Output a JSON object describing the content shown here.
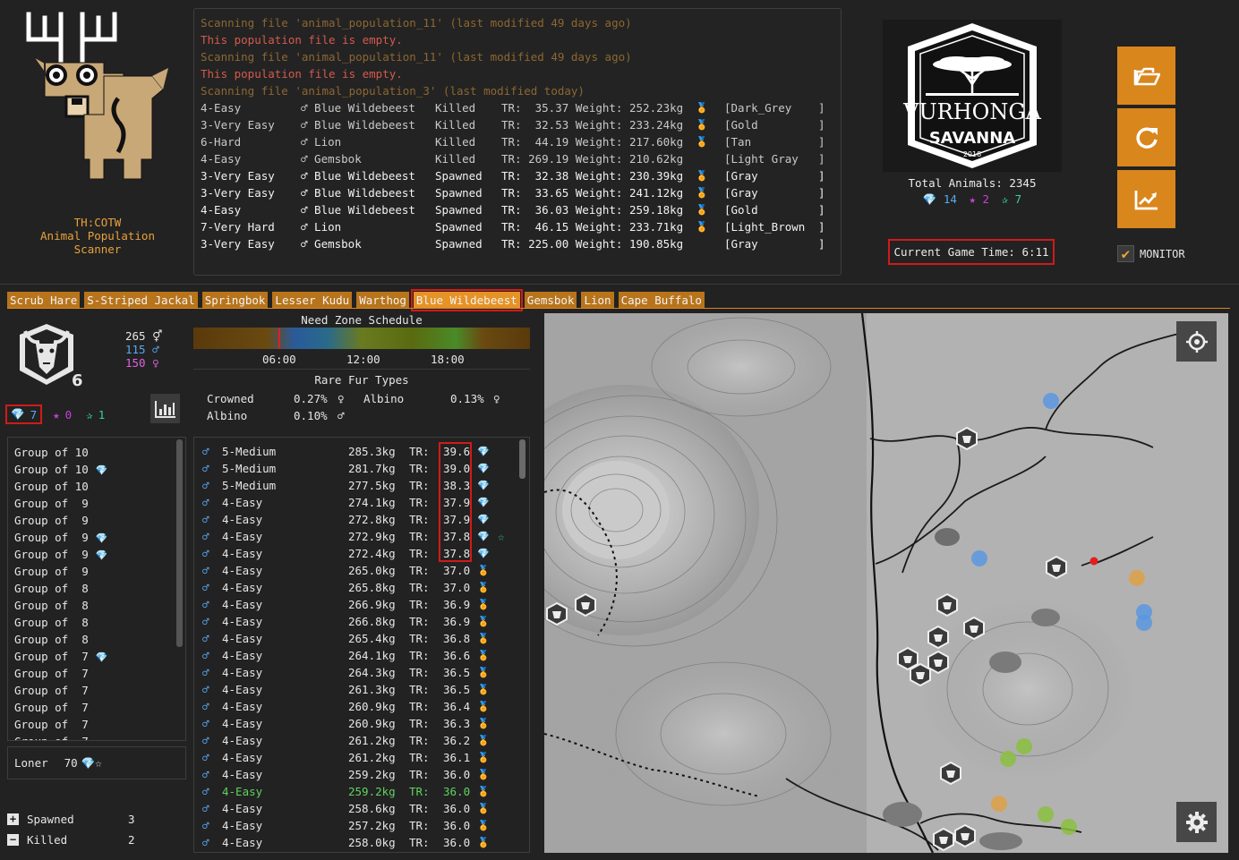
{
  "app": {
    "title_lines": [
      "TH:COTW",
      "Animal Population",
      "Scanner"
    ],
    "colors": {
      "accent": "#d9861d",
      "highlight": "#d11a1a",
      "diamond": "#5aa9f0",
      "rare": "#c93fd8",
      "great_one": "#33d4a0"
    }
  },
  "log": [
    {
      "cols": [
        "Scanning file 'animal_population_11' (last modified 49 days ago)"
      ],
      "kind": "scan"
    },
    {
      "cols": [
        "This population file is empty."
      ],
      "kind": "empty"
    },
    {
      "cols": [
        "Scanning file 'animal_population_11' (last modified 49 days ago)"
      ],
      "kind": "scan"
    },
    {
      "cols": [
        "This population file is empty."
      ],
      "kind": "empty"
    },
    {
      "cols": [
        "Scanning file 'animal_population_3' (last modified today)"
      ],
      "kind": "scan"
    },
    {
      "kind": "kill",
      "cols": [
        "4-Easy",
        "♂ Blue Wildebeest",
        "Killed",
        "TR:  35.37 Weight: 252.23kg",
        "🏅",
        "[Dark_Grey",
        "]"
      ]
    },
    {
      "kind": "kill",
      "cols": [
        "3-Very Easy",
        "♂ Blue Wildebeest",
        "Killed",
        "TR:  32.53 Weight: 233.24kg",
        "🏅",
        "[Gold",
        "]"
      ]
    },
    {
      "kind": "kill",
      "cols": [
        "6-Hard",
        "♂ Lion",
        "Killed",
        "TR:  44.19 Weight: 217.60kg",
        "🏅",
        "[Tan",
        "]"
      ]
    },
    {
      "kind": "kill",
      "cols": [
        "4-Easy",
        "♂ Gemsbok",
        "Killed",
        "TR: 269.19 Weight: 210.62kg",
        "",
        "[Light Gray",
        "]"
      ]
    },
    {
      "kind": "spawn",
      "cols": [
        "3-Very Easy",
        "♂ Blue Wildebeest",
        "Spawned",
        "TR:  32.38 Weight: 230.39kg",
        "🏅",
        "[Gray",
        "]"
      ]
    },
    {
      "kind": "spawn",
      "cols": [
        "3-Very Easy",
        "♂ Blue Wildebeest",
        "Spawned",
        "TR:  33.65 Weight: 241.12kg",
        "🏅",
        "[Gray",
        "]"
      ]
    },
    {
      "kind": "spawn",
      "cols": [
        "4-Easy",
        "♂ Blue Wildebeest",
        "Spawned",
        "TR:  36.03 Weight: 259.18kg",
        "🏅",
        "[Gold",
        "]"
      ]
    },
    {
      "kind": "spawn",
      "cols": [
        "7-Very Hard",
        "♂ Lion",
        "Spawned",
        "TR:  46.15 Weight: 233.71kg",
        "🏅",
        "[Light_Brown",
        "]"
      ]
    },
    {
      "kind": "spawn",
      "cols": [
        "3-Very Easy",
        "♂ Gemsbok",
        "Spawned",
        "TR: 225.00 Weight: 190.85kg",
        "",
        "[Gray",
        "]"
      ]
    }
  ],
  "reserve": {
    "badge_text": "VURHONGA",
    "badge_sub": "SAVANNA",
    "badge_year": "2018",
    "total_animals": "Total Animals: 2345",
    "diamonds": "14",
    "rares": "2",
    "great_ones": "7",
    "game_time": "Current Game Time: 6:11"
  },
  "buttons": {
    "open_icon": "folder-open-icon",
    "refresh_icon": "refresh-icon",
    "stats_icon": "chart-line-icon",
    "monitor_label": "MONITOR",
    "monitor_checked": true
  },
  "tabs": [
    "Scrub Hare",
    "S-Striped Jackal",
    "Springbok",
    "Lesser Kudu",
    "Warthog",
    "Blue Wildebeest",
    "Gemsbok",
    "Lion",
    "Cape Buffalo"
  ],
  "active_tab": "Blue Wildebeest",
  "species": {
    "max_level": "6",
    "total": "265",
    "males": "115",
    "females": "150",
    "diamonds": "7",
    "rares": "0",
    "great_ones": "1"
  },
  "need_zone": {
    "title": "Need Zone Schedule",
    "times": [
      "06:00",
      "12:00",
      "18:00"
    ],
    "current_time_fraction": 0.256
  },
  "rare_furs": {
    "title": "Rare Fur Types",
    "rows": [
      {
        "name": "Crowned",
        "pct": "0.27%",
        "sex": "♀",
        "name2": "Albino",
        "pct2": "0.13%",
        "sex2": "♀"
      },
      {
        "name": "Albino",
        "pct": "0.10%",
        "sex": "♂",
        "name2": "",
        "pct2": "",
        "sex2": ""
      }
    ]
  },
  "groups": [
    {
      "label": "Group of 10",
      "icons": ""
    },
    {
      "label": "Group of 10",
      "icons": "💎"
    },
    {
      "label": "Group of 10",
      "icons": ""
    },
    {
      "label": "Group of  9",
      "icons": ""
    },
    {
      "label": "Group of  9",
      "icons": ""
    },
    {
      "label": "Group of  9",
      "icons": "💎"
    },
    {
      "label": "Group of  9",
      "icons": "💎"
    },
    {
      "label": "Group of  9",
      "icons": ""
    },
    {
      "label": "Group of  8",
      "icons": ""
    },
    {
      "label": "Group of  8",
      "icons": ""
    },
    {
      "label": "Group of  8",
      "icons": ""
    },
    {
      "label": "Group of  8",
      "icons": ""
    },
    {
      "label": "Group of  7",
      "icons": "💎"
    },
    {
      "label": "Group of  7",
      "icons": ""
    },
    {
      "label": "Group of  7",
      "icons": ""
    },
    {
      "label": "Group of  7",
      "icons": ""
    },
    {
      "label": "Group of  7",
      "icons": ""
    },
    {
      "label": "Group of  7",
      "icons": ""
    }
  ],
  "loner": {
    "label": "Loner",
    "count": "70",
    "icons": "💎☆"
  },
  "legend": [
    {
      "sym": "+",
      "label": "Spawned",
      "value": "3"
    },
    {
      "sym": "−",
      "label": "Killed",
      "value": "2"
    }
  ],
  "animals": [
    {
      "sex": "♂",
      "level": "5-Medium",
      "weight": "285.3kg",
      "tr_label": "TR:",
      "tr": "39.6",
      "medal": "diamond",
      "extra": ""
    },
    {
      "sex": "♂",
      "level": "5-Medium",
      "weight": "281.7kg",
      "tr_label": "TR:",
      "tr": "39.0",
      "medal": "diamond",
      "extra": ""
    },
    {
      "sex": "♂",
      "level": "5-Medium",
      "weight": "277.5kg",
      "tr_label": "TR:",
      "tr": "38.3",
      "medal": "diamond",
      "extra": ""
    },
    {
      "sex": "♂",
      "level": "4-Easy",
      "weight": "274.1kg",
      "tr_label": "TR:",
      "tr": "37.9",
      "medal": "diamond",
      "extra": ""
    },
    {
      "sex": "♂",
      "level": "4-Easy",
      "weight": "272.8kg",
      "tr_label": "TR:",
      "tr": "37.9",
      "medal": "diamond",
      "extra": ""
    },
    {
      "sex": "♂",
      "level": "4-Easy",
      "weight": "272.9kg",
      "tr_label": "TR:",
      "tr": "37.8",
      "medal": "diamond",
      "extra": "☆"
    },
    {
      "sex": "♂",
      "level": "4-Easy",
      "weight": "272.4kg",
      "tr_label": "TR:",
      "tr": "37.8",
      "medal": "diamond",
      "extra": ""
    },
    {
      "sex": "♂",
      "level": "4-Easy",
      "weight": "265.0kg",
      "tr_label": "TR:",
      "tr": "37.0",
      "medal": "gold",
      "extra": ""
    },
    {
      "sex": "♂",
      "level": "4-Easy",
      "weight": "265.8kg",
      "tr_label": "TR:",
      "tr": "37.0",
      "medal": "gold",
      "extra": ""
    },
    {
      "sex": "♂",
      "level": "4-Easy",
      "weight": "266.9kg",
      "tr_label": "TR:",
      "tr": "36.9",
      "medal": "gold",
      "extra": ""
    },
    {
      "sex": "♂",
      "level": "4-Easy",
      "weight": "266.8kg",
      "tr_label": "TR:",
      "tr": "36.9",
      "medal": "gold",
      "extra": ""
    },
    {
      "sex": "♂",
      "level": "4-Easy",
      "weight": "265.4kg",
      "tr_label": "TR:",
      "tr": "36.8",
      "medal": "gold",
      "extra": ""
    },
    {
      "sex": "♂",
      "level": "4-Easy",
      "weight": "264.1kg",
      "tr_label": "TR:",
      "tr": "36.6",
      "medal": "gold",
      "extra": ""
    },
    {
      "sex": "♂",
      "level": "4-Easy",
      "weight": "264.3kg",
      "tr_label": "TR:",
      "tr": "36.5",
      "medal": "gold",
      "extra": ""
    },
    {
      "sex": "♂",
      "level": "4-Easy",
      "weight": "261.3kg",
      "tr_label": "TR:",
      "tr": "36.5",
      "medal": "gold",
      "extra": ""
    },
    {
      "sex": "♂",
      "level": "4-Easy",
      "weight": "260.9kg",
      "tr_label": "TR:",
      "tr": "36.4",
      "medal": "gold",
      "extra": ""
    },
    {
      "sex": "♂",
      "level": "4-Easy",
      "weight": "260.9kg",
      "tr_label": "TR:",
      "tr": "36.3",
      "medal": "gold",
      "extra": ""
    },
    {
      "sex": "♂",
      "level": "4-Easy",
      "weight": "261.2kg",
      "tr_label": "TR:",
      "tr": "36.2",
      "medal": "gold",
      "extra": ""
    },
    {
      "sex": "♂",
      "level": "4-Easy",
      "weight": "261.2kg",
      "tr_label": "TR:",
      "tr": "36.1",
      "medal": "gold",
      "extra": ""
    },
    {
      "sex": "♂",
      "level": "4-Easy",
      "weight": "259.2kg",
      "tr_label": "TR:",
      "tr": "36.0",
      "medal": "gold",
      "extra": ""
    },
    {
      "sex": "♂",
      "level": "4-Easy",
      "weight": "259.2kg",
      "tr_label": "TR:",
      "tr": "36.0",
      "medal": "gold",
      "extra": "",
      "highlight": true
    },
    {
      "sex": "♂",
      "level": "4-Easy",
      "weight": "258.6kg",
      "tr_label": "TR:",
      "tr": "36.0",
      "medal": "gold",
      "extra": ""
    },
    {
      "sex": "♂",
      "level": "4-Easy",
      "weight": "257.2kg",
      "tr_label": "TR:",
      "tr": "36.0",
      "medal": "gold",
      "extra": ""
    },
    {
      "sex": "♂",
      "level": "4-Easy",
      "weight": "258.0kg",
      "tr_label": "TR:",
      "tr": "36.0",
      "medal": "gold",
      "extra": ""
    }
  ],
  "map": {
    "center_icon": "crosshair-icon",
    "settings_icon": "gear-icon",
    "markers": [
      {
        "kind": "herd",
        "count": 14
      },
      {
        "kind": "blue-dot",
        "count": 4
      },
      {
        "kind": "orange-dot",
        "count": 2
      },
      {
        "kind": "green-dot",
        "count": 4
      },
      {
        "kind": "player",
        "count": 1
      }
    ]
  }
}
